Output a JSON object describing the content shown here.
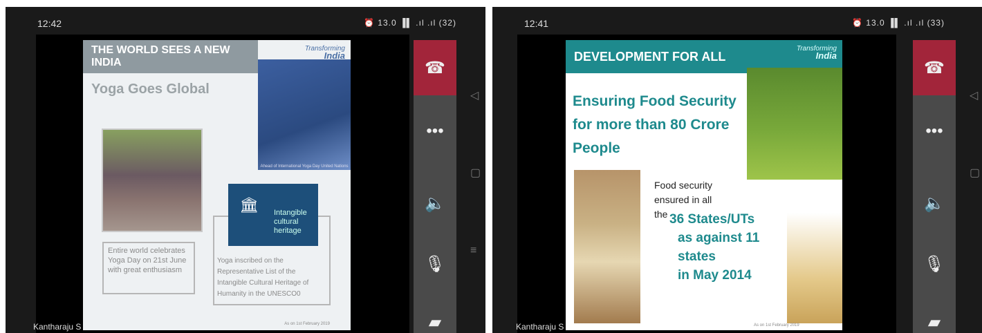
{
  "left_call": {
    "status_time": "12:42",
    "status_icons": "⏰ 13.0 ▐▌ .ıl .ıl (32)",
    "participant_name": "Kantharaju S",
    "slide": {
      "header": "THE WORLD SEES A NEW INDIA",
      "brand_small": "Transforming",
      "brand_big": "India",
      "title": "Yoga Goes Global",
      "tower_caption": "Ahead of International Yoga Day United Nations",
      "caption1": "Entire world celebrates Yoga Day on 21st June with great enthusiasm",
      "unesco_text": "Intangible cultural heritage",
      "caption2": "Yoga inscribed on the Representative List of the Intangible Cultural Heritage of Humanity in the UNESCO0",
      "asof": "As on 1st February 2019"
    }
  },
  "right_call": {
    "status_time": "12:41",
    "status_icons": "⏰ 13.0 ▐▌ .ıl .ıl (33)",
    "participant_name": "Kantharaju S",
    "slide": {
      "header": "DEVELOPMENT FOR ALL",
      "brand_small": "Transforming",
      "brand_big": "India",
      "heading": "Ensuring Food Security for more than 80 Crore People",
      "food_l1": "Food security",
      "food_l2": "ensured in all",
      "food_l3": "the",
      "states_l1": "36 States/UTs",
      "states_l2": "as against 11",
      "states_l3": "states",
      "states_l4": "in May 2014",
      "asof": "As on 1st February 2019"
    }
  },
  "call_controls": {
    "end_icon": "phone-end",
    "more_label": "•••",
    "speaker_icon": "speaker",
    "mic_icon": "mic-off",
    "video_icon": "video-off"
  }
}
